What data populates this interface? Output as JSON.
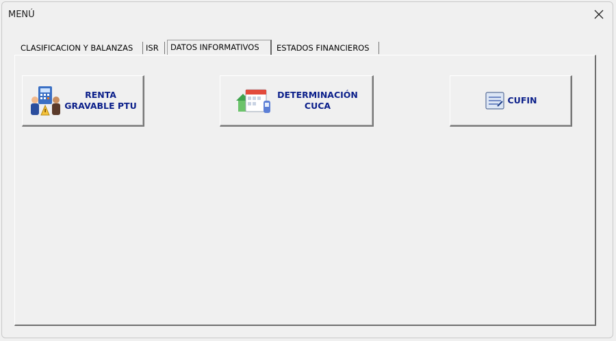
{
  "window": {
    "title": "MENÚ"
  },
  "tabs": [
    {
      "label": "CLASIFICACION Y BALANZAS",
      "active": false
    },
    {
      "label": "ISR",
      "active": false
    },
    {
      "label": "DATOS INFORMATIVOS",
      "active": true
    },
    {
      "label": "ESTADOS FINANCIEROS",
      "active": false
    }
  ],
  "buttons": {
    "renta": {
      "label": "RENTA\nGRAVABLE PTU",
      "icon": "calculator-people-icon"
    },
    "cuca": {
      "label": "DETERMINACIÓN\nCUCA",
      "icon": "calendar-house-icon"
    },
    "cufin": {
      "label": "CUFIN",
      "icon": "ledger-icon"
    }
  },
  "colors": {
    "button_text": "#0b1f8a",
    "background": "#f0f0f0"
  }
}
